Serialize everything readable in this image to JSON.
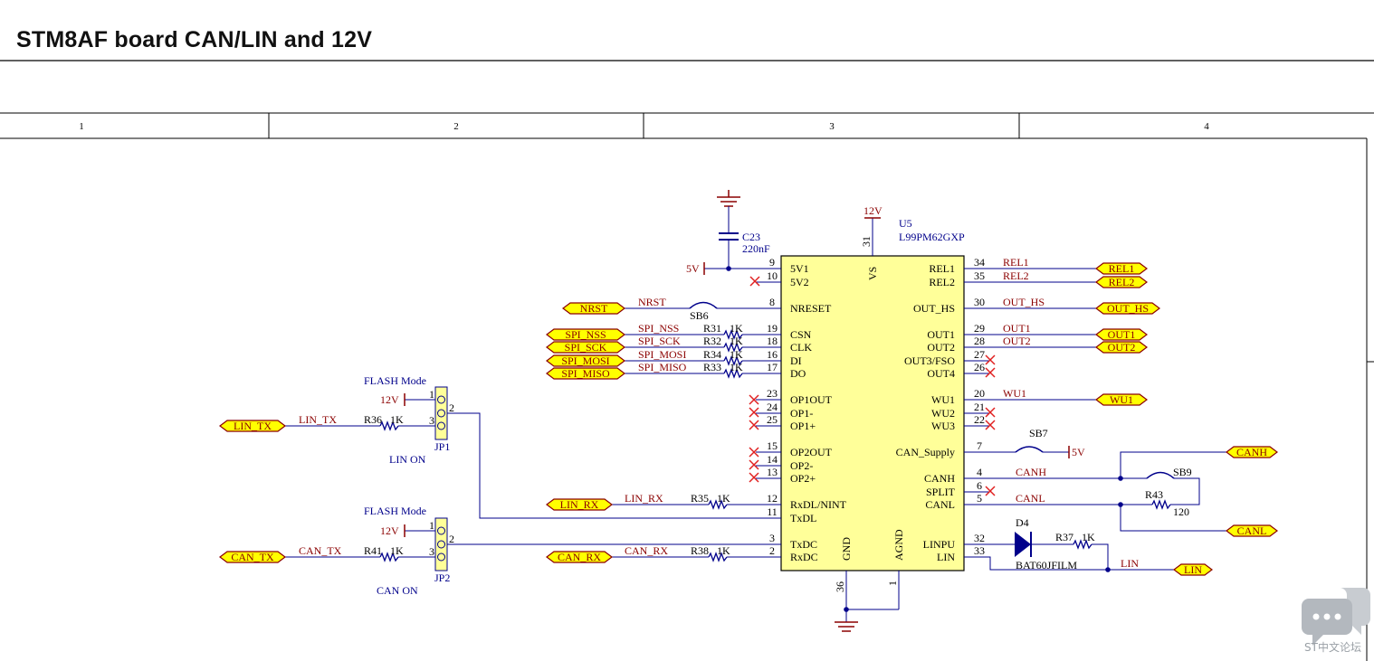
{
  "title": "STM8AF board CAN/LIN and 12V",
  "colors": {
    "wire": "#00008b",
    "net": "#8b0000",
    "chip": "#ffff99",
    "port": "#ffff00",
    "nc": "#e02020",
    "pin": "#000080",
    "border": "#000000"
  },
  "columns": [
    "1",
    "2",
    "3",
    "4"
  ],
  "chip": {
    "ref": "U5",
    "part": "L99PM62GXP",
    "vs_pin": "31",
    "vs_name": "VS",
    "gnd_name": "GND",
    "agnd_name": "AGND",
    "gnd_pin": "36",
    "agnd_pin": "1",
    "left_pins": [
      {
        "num": "9",
        "name": "5V1"
      },
      {
        "num": "10",
        "name": "5V2"
      },
      {
        "num": "8",
        "name": "NRESET"
      },
      {
        "num": "19",
        "name": "CSN"
      },
      {
        "num": "18",
        "name": "CLK"
      },
      {
        "num": "16",
        "name": "DI"
      },
      {
        "num": "17",
        "name": "DO"
      },
      {
        "num": "23",
        "name": "OP1OUT"
      },
      {
        "num": "24",
        "name": "OP1-"
      },
      {
        "num": "25",
        "name": "OP1+"
      },
      {
        "num": "15",
        "name": "OP2OUT"
      },
      {
        "num": "14",
        "name": "OP2-"
      },
      {
        "num": "13",
        "name": "OP2+"
      },
      {
        "num": "12",
        "name": "RxDL/NINT"
      },
      {
        "num": "11",
        "name": "TxDL"
      },
      {
        "num": "3",
        "name": "TxDC"
      },
      {
        "num": "2",
        "name": "RxDC"
      }
    ],
    "right_pins": [
      {
        "num": "34",
        "name": "REL1"
      },
      {
        "num": "35",
        "name": "REL2"
      },
      {
        "num": "30",
        "name": "OUT_HS"
      },
      {
        "num": "29",
        "name": "OUT1"
      },
      {
        "num": "28",
        "name": "OUT2"
      },
      {
        "num": "27",
        "name": "OUT3/FSO"
      },
      {
        "num": "26",
        "name": "OUT4"
      },
      {
        "num": "20",
        "name": "WU1"
      },
      {
        "num": "21",
        "name": "WU2"
      },
      {
        "num": "22",
        "name": "WU3"
      },
      {
        "num": "7",
        "name": "CAN_Supply"
      },
      {
        "num": "4",
        "name": "CANH"
      },
      {
        "num": "6",
        "name": "SPLIT"
      },
      {
        "num": "5",
        "name": "CANL"
      },
      {
        "num": "32",
        "name": "LINPU"
      },
      {
        "num": "33",
        "name": "LIN"
      }
    ]
  },
  "power": {
    "v12": "12V",
    "v5": "5V"
  },
  "cap": {
    "ref": "C23",
    "value": "220nF"
  },
  "solder_bridges": {
    "sb6": "SB6",
    "sb7": "SB7",
    "sb9": "SB9"
  },
  "resistors": {
    "r31": "R31",
    "r32": "R32",
    "r34": "R34",
    "r33": "R33",
    "r35": "R35",
    "r38": "R38",
    "r36": "R36",
    "r41": "R41",
    "r37": "R37",
    "r43": "R43",
    "val1k": "1K",
    "val120": "120"
  },
  "diode": {
    "ref": "D4",
    "part": "BAT60JFILM"
  },
  "jumpers": {
    "jp1": {
      "ref": "JP1",
      "top": "FLASH Mode",
      "bottom": "LIN ON"
    },
    "jp2": {
      "ref": "JP2",
      "top": "FLASH Mode",
      "bottom": "CAN ON"
    },
    "pins": [
      "1",
      "2",
      "3"
    ]
  },
  "nets": {
    "nrst": "NRST",
    "spi_nss": "SPI_NSS",
    "spi_sck": "SPI_SCK",
    "spi_mosi": "SPI_MOSI",
    "spi_miso": "SPI_MISO",
    "lin_rx": "LIN_RX",
    "can_rx": "CAN_RX",
    "lin_tx": "LIN_TX",
    "can_tx": "CAN_TX",
    "rel1": "REL1",
    "rel2": "REL2",
    "out_hs": "OUT_HS",
    "out1": "OUT1",
    "out2": "OUT2",
    "wu1": "WU1",
    "canh": "CANH",
    "canl": "CANL",
    "lin": "LIN"
  },
  "watermark": {
    "text": "ST中文论坛",
    "icon": "chat-bubbles-icon"
  }
}
